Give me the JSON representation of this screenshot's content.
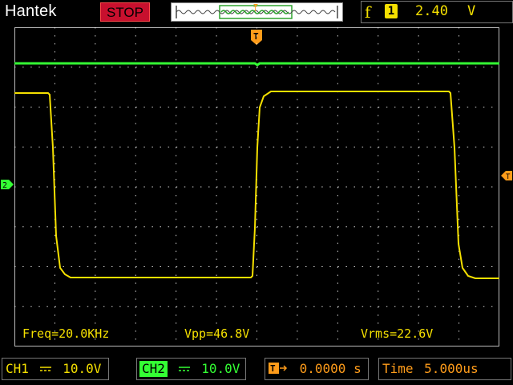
{
  "header": {
    "brand": "Hantek",
    "run_state": "STOP",
    "trigger": {
      "slope_symbol": "f",
      "source": "1",
      "level": "2.40",
      "unit": "V"
    },
    "trigger_marker": "T"
  },
  "measurements": {
    "freq": "Freq=20.0KHz",
    "vpp": "Vpp=46.8V",
    "vrms": "Vrms=22.6V"
  },
  "footer": {
    "ch1": {
      "label": "CH1",
      "coupling": "DC",
      "scale": "10.0V"
    },
    "ch2": {
      "label": "CH2",
      "coupling": "DC",
      "scale": "10.0V"
    },
    "trigger_position": {
      "icon": "T",
      "value": "0.0000 s"
    },
    "timebase": {
      "label": "Time",
      "value": "5.000us"
    }
  },
  "colors": {
    "ch1": "#f5e000",
    "ch2": "#34ff34",
    "accent": "#ff9c1a",
    "stop": "#c8102e",
    "grid": "#ffffff"
  }
}
